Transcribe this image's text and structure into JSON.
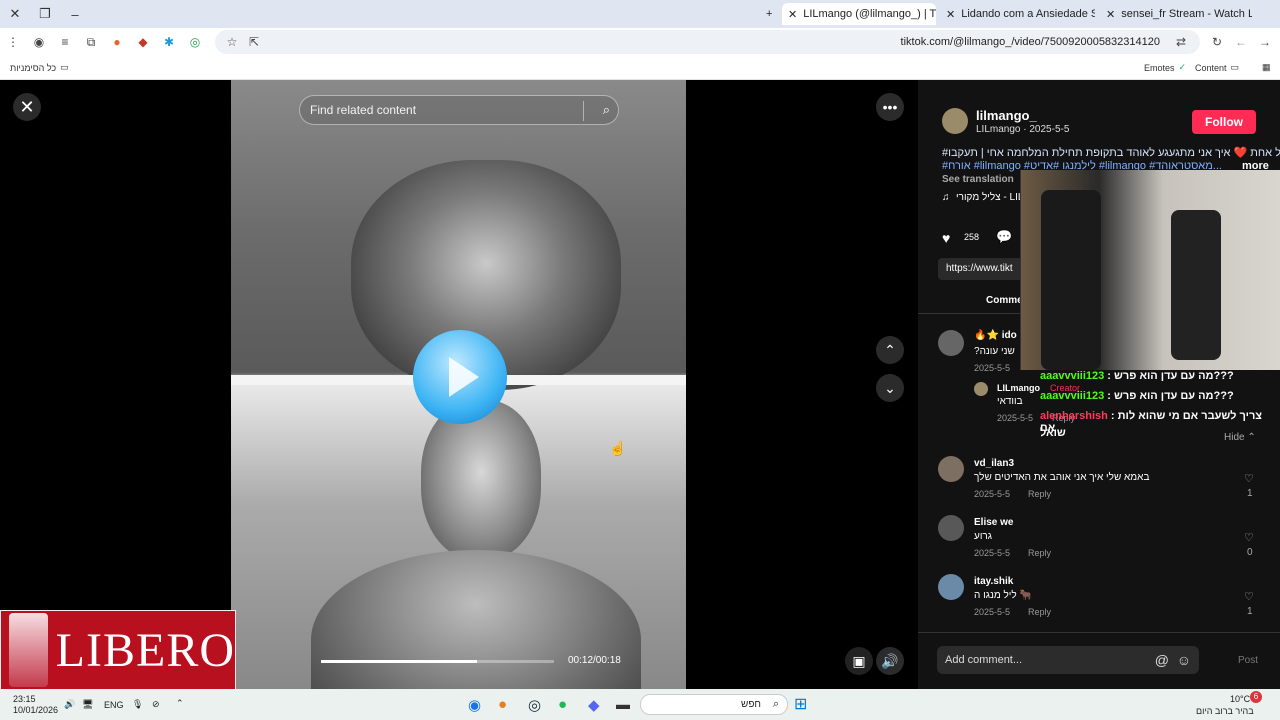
{
  "tabs": [
    {
      "label": "LILmango (@lilmango_) | TikTo",
      "active": true
    },
    {
      "label": "Lidando com a Ansiedade Soc"
    },
    {
      "label": "sensei_fr Stream - Watch Live o"
    }
  ],
  "url": "tiktok.com/@lilmango_/video/7500920005832314120",
  "bookmarks": {
    "all": "כל הסימניות",
    "emotes": "Emotes",
    "content": "Content"
  },
  "video": {
    "search_placeholder": "Find related content",
    "time": "00:12/00:18",
    "progress": 0.67
  },
  "ad": {
    "brand": "LIBERO"
  },
  "author": {
    "handle": "lilmango_",
    "name_date": "LILmango · 2025-5-5",
    "follow": "Follow",
    "caption_line1": "#ריל אחת ❤️ איך אני מתגעגע לאוהד בתקופת תחילת המלחמה אחי | תעקבו",
    "caption_line2": "#אורח #lilmango #לילמנגו #אדיט #lilmango #מאסטראוהד...",
    "more": "more",
    "see_translation": "See translation",
    "sound": "צליל מקורי - LIL"
  },
  "stats": {
    "likes": "258"
  },
  "link": "https://www.tikt",
  "comments_tab": "Comme",
  "comments": [
    {
      "user": "ido",
      "text": "?שני עונה",
      "date": "2025-5-5"
    },
    {
      "user": "LILmango",
      "badge": "Creator",
      "text": "בוודאי",
      "date": "2025-5-5",
      "reply": "Reply"
    },
    {
      "user": "vd_ilan3",
      "text": "באמא שלי איך אני אוהב את האדיטים שלך",
      "date": "2025-5-5",
      "reply": "Reply",
      "likes": "1"
    },
    {
      "user": "Elise we",
      "text": "גרוע",
      "date": "2025-5-5",
      "reply": "Reply",
      "likes": "0"
    },
    {
      "user": "itay.shik",
      "text": "ליל מנגו ה 🐂",
      "date": "2025-5-5",
      "reply": "Reply",
      "likes": "1"
    }
  ],
  "hide": "Hide",
  "chat": [
    {
      "user": "aaavvviii123",
      "text": ": מה עם עדן הוא פרש???"
    },
    {
      "user": "aaavvviii123",
      "text": ": מה עם עדן הוא פרש???"
    },
    {
      "user": "alenharshish",
      "text": ": צריך לשעבר אם מי שהוא לות אח"
    },
    {
      "user": "",
      "text": "שואל"
    }
  ],
  "add_comment": "Add comment...",
  "post": "Post",
  "taskbar": {
    "time": "23:15",
    "date": "10/01/2026",
    "lang": "ENG",
    "search": "חפש",
    "weather_temp": "10°C",
    "weather_desc": "בהיר ברוב היום",
    "badge": "6"
  }
}
